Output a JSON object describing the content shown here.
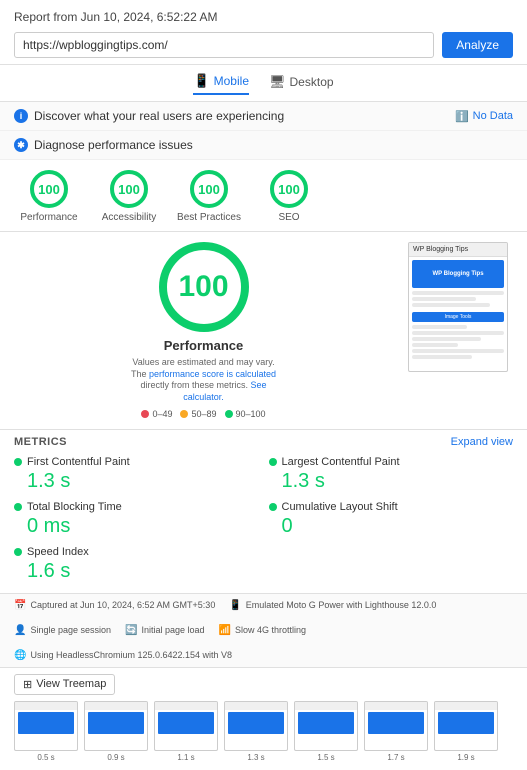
{
  "report": {
    "title": "Report from Jun 10, 2024, 6:52:22 AM",
    "url": "https://wpbloggingtips.com/",
    "analyze_label": "Analyze",
    "tabs": [
      {
        "id": "mobile",
        "label": "Mobile",
        "active": true
      },
      {
        "id": "desktop",
        "label": "Desktop",
        "active": false
      }
    ],
    "real_users_label": "Discover what your real users are experiencing",
    "no_data_label": "No Data",
    "diagnose_label": "Diagnose performance issues"
  },
  "scores": [
    {
      "id": "performance",
      "value": "100",
      "label": "Performance"
    },
    {
      "id": "accessibility",
      "value": "100",
      "label": "Accessibility"
    },
    {
      "id": "best_practices",
      "value": "100",
      "label": "Best Practices"
    },
    {
      "id": "seo",
      "value": "100",
      "label": "SEO"
    }
  ],
  "big_score": {
    "value": "100",
    "label": "Performance",
    "note": "Values are estimated and may vary. The performance score is calculated directly from these metrics.",
    "note_link": "See calculator.",
    "legend": [
      {
        "color": "#e84855",
        "range": "0–49"
      },
      {
        "color": "#f9a825",
        "range": "50–89"
      },
      {
        "color": "#0cce6b",
        "range": "90–100"
      }
    ]
  },
  "screenshot": {
    "title": "WP Blogging Tips",
    "label": "Image Tools"
  },
  "metrics": {
    "title": "METRICS",
    "expand_label": "Expand view",
    "items": [
      {
        "id": "fcp",
        "label": "First Contentful Paint",
        "value": "1.3 s"
      },
      {
        "id": "lcp",
        "label": "Largest Contentful Paint",
        "value": "1.3 s"
      },
      {
        "id": "tbt",
        "label": "Total Blocking Time",
        "value": "0 ms"
      },
      {
        "id": "cls",
        "label": "Cumulative Layout Shift",
        "value": "0"
      },
      {
        "id": "si",
        "label": "Speed Index",
        "value": "1.6 s"
      }
    ]
  },
  "footer_info": [
    {
      "icon": "📅",
      "text": "Captured at Jun 10, 2024, 6:52 AM GMT+5:30"
    },
    {
      "icon": "📱",
      "text": "Emulated Moto G Power with Lighthouse 12.0.0"
    },
    {
      "icon": "👤",
      "text": "Single page session"
    },
    {
      "icon": "🔄",
      "text": "Initial page load"
    },
    {
      "icon": "📶",
      "text": "Slow 4G throttling"
    },
    {
      "icon": "🌐",
      "text": "Using HeadlessChromium 125.0.6422.154 with V8"
    }
  ],
  "filmstrip": {
    "view_treemap_label": "View Treemap",
    "captions": [
      "0.5 s",
      "0.9 s",
      "1.1 s",
      "1.3 s",
      "1.5 s",
      "1.7 s",
      "1.9 s"
    ]
  }
}
